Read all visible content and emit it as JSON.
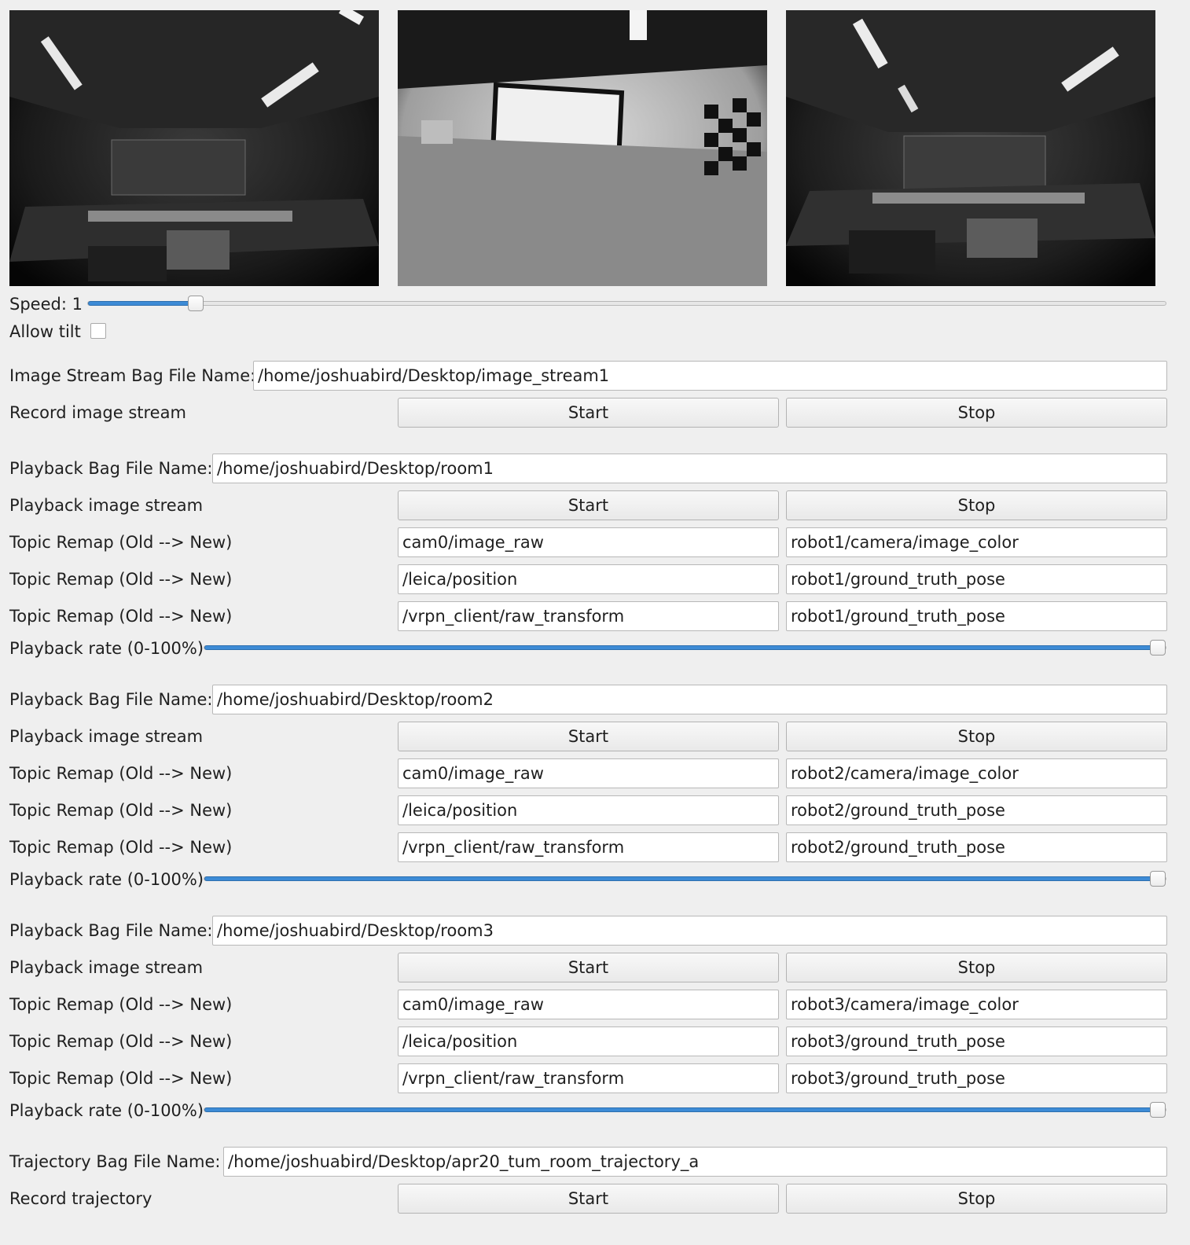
{
  "speed": {
    "label": "Speed: 1",
    "value": 0.1
  },
  "allow_tilt": {
    "label": "Allow tilt",
    "checked": false
  },
  "image_stream": {
    "label": "Image Stream Bag File Name:",
    "value": "/home/joshuabird/Desktop/image_stream1",
    "record_label": "Record image stream",
    "start": "Start",
    "stop": "Stop"
  },
  "playbacks": [
    {
      "bag_label": "Playback Bag File Name:",
      "bag_value": "/home/joshuabird/Desktop/room1",
      "stream_label": "Playback image stream",
      "start": "Start",
      "stop": "Stop",
      "remaps": [
        {
          "label": "Topic Remap (Old --> New)",
          "old": "cam0/image_raw",
          "new": "robot1/camera/image_color"
        },
        {
          "label": "Topic Remap (Old --> New)",
          "old": "/leica/position",
          "new": "robot1/ground_truth_pose"
        },
        {
          "label": "Topic Remap (Old --> New)",
          "old": "/vrpn_client/raw_transform",
          "new": "robot1/ground_truth_pose"
        }
      ],
      "rate_label": "Playback rate (0-100%)",
      "rate": 100
    },
    {
      "bag_label": "Playback Bag File Name:",
      "bag_value": "/home/joshuabird/Desktop/room2",
      "stream_label": "Playback image stream",
      "start": "Start",
      "stop": "Stop",
      "remaps": [
        {
          "label": "Topic Remap (Old --> New)",
          "old": "cam0/image_raw",
          "new": "robot2/camera/image_color"
        },
        {
          "label": "Topic Remap (Old --> New)",
          "old": "/leica/position",
          "new": "robot2/ground_truth_pose"
        },
        {
          "label": "Topic Remap (Old --> New)",
          "old": "/vrpn_client/raw_transform",
          "new": "robot2/ground_truth_pose"
        }
      ],
      "rate_label": "Playback rate (0-100%)",
      "rate": 100
    },
    {
      "bag_label": "Playback Bag File Name:",
      "bag_value": "/home/joshuabird/Desktop/room3",
      "stream_label": "Playback image stream",
      "start": "Start",
      "stop": "Stop",
      "remaps": [
        {
          "label": "Topic Remap (Old --> New)",
          "old": "cam0/image_raw",
          "new": "robot3/camera/image_color"
        },
        {
          "label": "Topic Remap (Old --> New)",
          "old": "/leica/position",
          "new": "robot3/ground_truth_pose"
        },
        {
          "label": "Topic Remap (Old --> New)",
          "old": "/vrpn_client/raw_transform",
          "new": "robot3/ground_truth_pose"
        }
      ],
      "rate_label": "Playback rate (0-100%)",
      "rate": 100
    }
  ],
  "trajectory": {
    "label": "Trajectory Bag File Name:",
    "value": "/home/joshuabird/Desktop/apr20_tum_room_trajectory_a",
    "record_label": "Record trajectory",
    "start": "Start",
    "stop": "Stop"
  },
  "colors": {
    "accent": "#3d8bd6",
    "background": "#efefef"
  }
}
